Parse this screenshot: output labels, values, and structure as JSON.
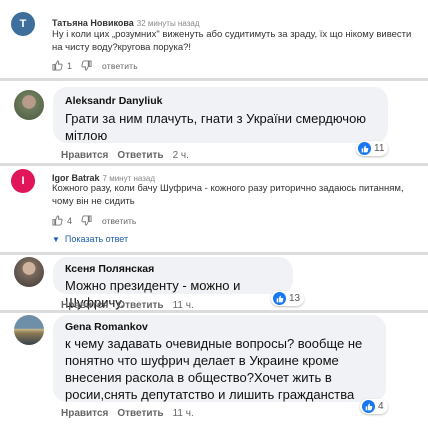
{
  "colors": {
    "accent_blue": "#1877f2",
    "avatar_t": "#3e6f9c",
    "avatar_i": "#e0155a",
    "link": "#1f5fa8"
  },
  "comments_top": [
    {
      "initial": "T",
      "name": "Татьяна Новикова",
      "time": "32 минуты назад",
      "text_lines": [
        "Ну і коли цих „розумних\" виженуть або судитимуть за зраду, їх що нікому вивести",
        "на чисту воду?кругова порука?!"
      ],
      "likes": "1",
      "reply_label": "ответить"
    }
  ],
  "c2": {
    "name": "Aleksandr Danyliuk",
    "text_lines": [
      "Грати за ним плачуть, гнати з України смердючою",
      "мітлою"
    ],
    "like_label": "Нравится",
    "reply_label": "Ответить",
    "time": "2 ч.",
    "reactions": "11"
  },
  "c3": {
    "initial": "I",
    "name": "Igor Batrak",
    "time": "7 минут назад",
    "text_lines": [
      "Кожного разу, коли бачу Шуфрича - кожного разу риторично задаюсь питанням,",
      "чому він не сидить"
    ],
    "likes": "4",
    "reply_label": "ответить",
    "show_replies": "Показать ответ"
  },
  "c4": {
    "name": "Ксеня Полянская",
    "text_lines": [
      "Можно президенту - можно и Шуфричу."
    ],
    "like_label": "Нравится",
    "reply_label": "Ответить",
    "time": "11 ч.",
    "reactions": "13"
  },
  "c5": {
    "name": "Gena Romankov",
    "text_lines": [
      "к чему задавать очевидные вопросы? вообще не",
      "понятно что шуфрич делает в Украине кроме",
      "внесения раскола в общество?Хочет жить в",
      "росии,снять депутатство и лишить гражданства"
    ],
    "like_label": "Нравится",
    "reply_label": "Ответить",
    "time": "11 ч.",
    "reactions": "4"
  }
}
